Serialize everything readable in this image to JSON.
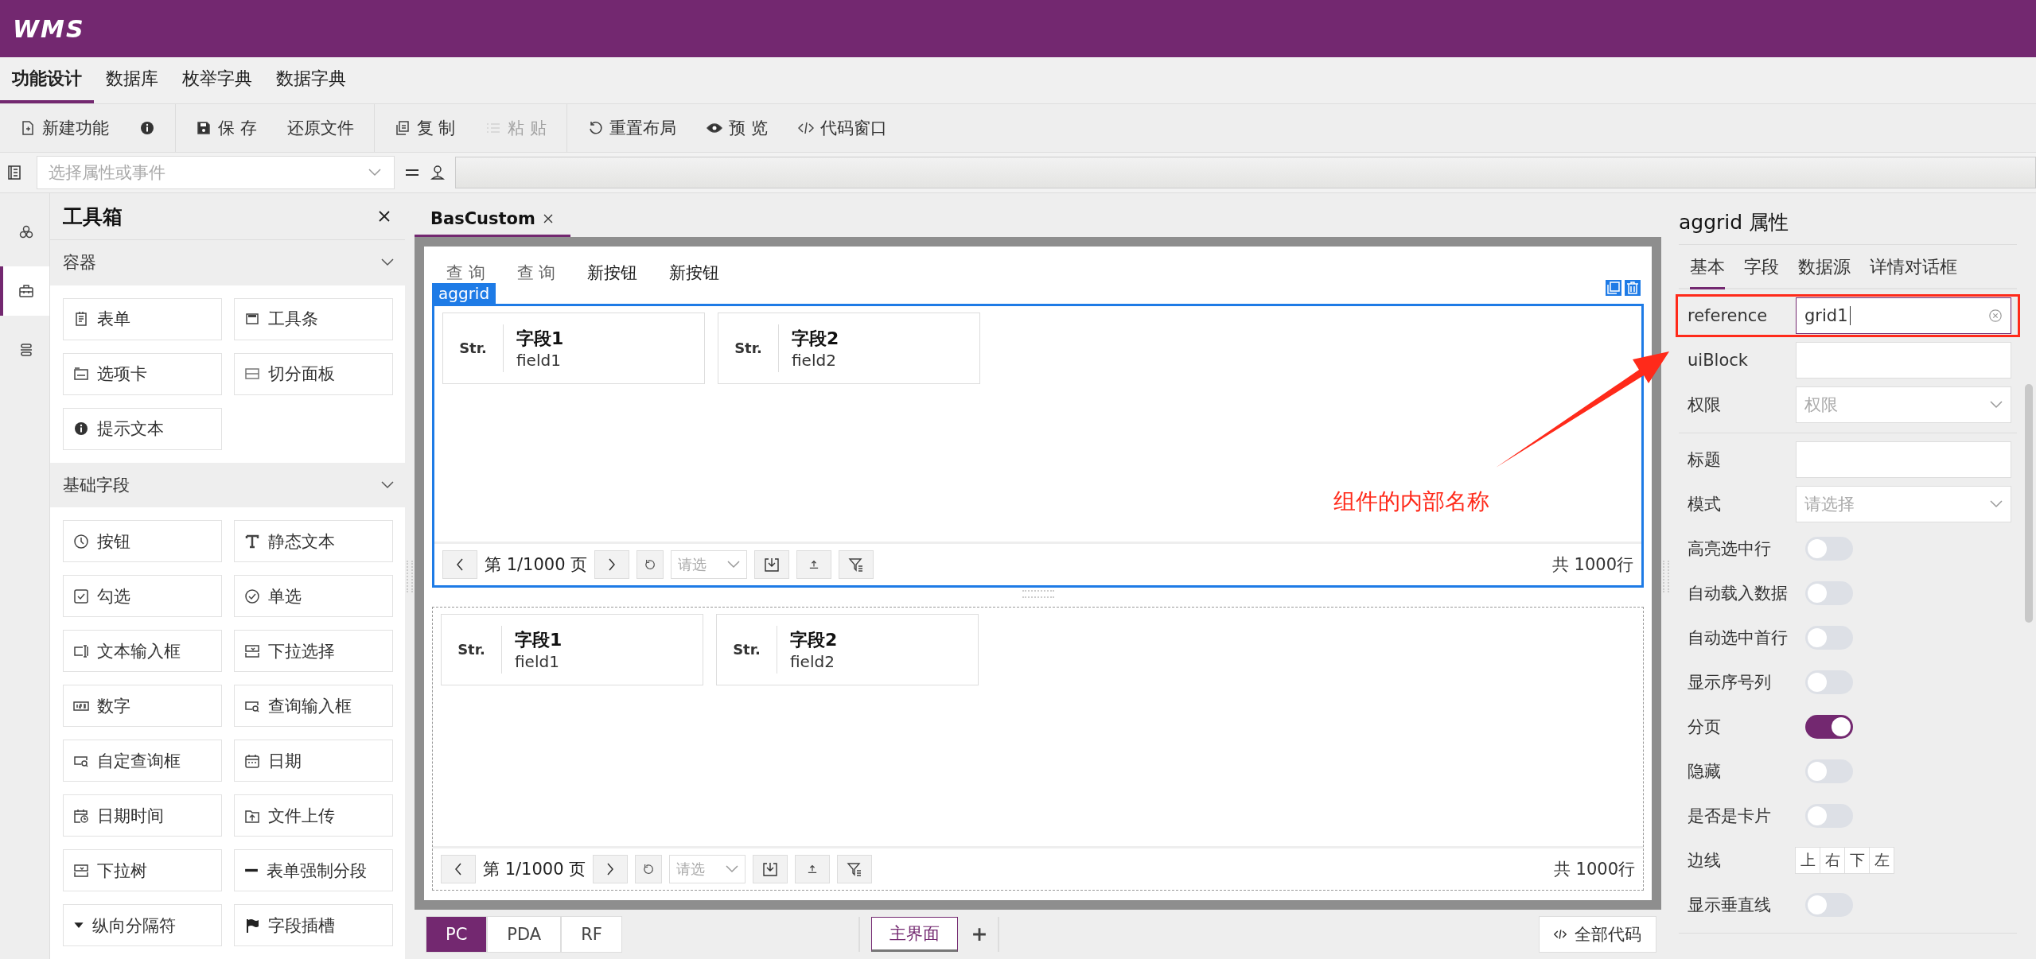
{
  "header": {
    "logo": "WMS"
  },
  "menu_tabs": [
    {
      "label": "功能设计",
      "selected": true
    },
    {
      "label": "数据库",
      "selected": false
    },
    {
      "label": "枚举字典",
      "selected": false
    },
    {
      "label": "数据字典",
      "selected": false
    }
  ],
  "toolbar": [
    [
      {
        "kind": "text",
        "label": "新建功能",
        "disabled": false
      },
      {
        "kind": "icon",
        "disabled": false
      }
    ],
    [
      {
        "label": "保 存",
        "disabled": false
      },
      {
        "label": "还原文件",
        "disabled": false
      }
    ],
    [
      {
        "label": "复 制",
        "disabled": false
      },
      {
        "label": "粘 贴",
        "disabled": true
      }
    ],
    [
      {
        "label": "重置布局",
        "disabled": false
      },
      {
        "label": "预 览",
        "disabled": false
      },
      {
        "label": "代码窗口",
        "disabled": false
      }
    ]
  ],
  "property_bar": {
    "placeholder": "选择属性或事件"
  },
  "side_rail": [
    {
      "selected": false
    },
    {
      "selected": true
    },
    {
      "selected": false
    }
  ],
  "toolbox": {
    "title": "工具箱",
    "sections": [
      {
        "title": "容器",
        "expanded": true,
        "items": [
          "表单",
          "工具条",
          "选项卡",
          "切分面板",
          "提示文本"
        ]
      },
      {
        "title": "基础字段",
        "expanded": true,
        "items": [
          "按钮",
          "静态文本",
          "勾选",
          "单选",
          "文本输入框",
          "下拉选择",
          "数字",
          "查询输入框",
          "自定查询框",
          "日期",
          "日期时间",
          "文件上传",
          "下拉树",
          "表单强制分段",
          "纵向分隔符",
          "字段插槽"
        ]
      }
    ]
  },
  "editor_tabs": [
    {
      "label": "BasCustom",
      "selected": true
    }
  ],
  "canvas": {
    "buttons": [
      {
        "label": "查 询",
        "disabled": true
      },
      {
        "label": "查 询",
        "disabled": true
      },
      {
        "label": "新按钮",
        "disabled": false
      },
      {
        "label": "新按钮",
        "disabled": false
      }
    ],
    "grids": [
      {
        "selected": true,
        "tag": "aggrid",
        "cards": [
          {
            "type": "Str.",
            "title": "字段1",
            "field": "field1"
          },
          {
            "type": "Str.",
            "title": "字段2",
            "field": "field2"
          }
        ],
        "pager": {
          "page": "第 1/1000 页",
          "placeholder": "请选",
          "total": "共 1000行"
        }
      },
      {
        "selected": false,
        "cards": [
          {
            "type": "Str.",
            "title": "字段1",
            "field": "field1"
          },
          {
            "type": "Str.",
            "title": "字段2",
            "field": "field2"
          }
        ],
        "pager": {
          "page": "第 1/1000 页",
          "placeholder": "请选",
          "total": "共 1000行"
        }
      }
    ]
  },
  "platform_tabs": [
    {
      "label": "PC",
      "selected": true
    },
    {
      "label": "PDA",
      "selected": false
    },
    {
      "label": "RF",
      "selected": false
    }
  ],
  "page_tabs": [
    {
      "label": "主界面",
      "selected": true
    }
  ],
  "all_code_button": "全部代码",
  "properties": {
    "title": "aggrid 属性",
    "tabs": [
      {
        "label": "基本",
        "selected": true
      },
      {
        "label": "字段",
        "selected": false
      },
      {
        "label": "数据源",
        "selected": false
      },
      {
        "label": "详情对话框",
        "selected": false
      }
    ],
    "groups": [
      [
        {
          "kind": "input",
          "label": "reference",
          "value": "grid1",
          "highlighted": true
        },
        {
          "kind": "input",
          "label": "uiBlock",
          "highlighted": false
        },
        {
          "kind": "select",
          "label": "权限",
          "placeholder": "权限",
          "highlighted": false
        }
      ],
      [
        {
          "kind": "input",
          "label": "标题",
          "highlighted": false
        },
        {
          "kind": "select",
          "label": "模式",
          "placeholder": "请选择",
          "highlighted": false
        },
        {
          "kind": "toggle",
          "label": "高亮选中行",
          "on": false
        },
        {
          "kind": "toggle",
          "label": "自动载入数据",
          "on": false
        },
        {
          "kind": "toggle",
          "label": "自动选中首行",
          "on": false
        },
        {
          "kind": "toggle",
          "label": "显示序号列",
          "on": false
        },
        {
          "kind": "toggle",
          "label": "分页",
          "on": true
        },
        {
          "kind": "toggle",
          "label": "隐藏",
          "on": false
        },
        {
          "kind": "toggle",
          "label": "是否是卡片",
          "on": false
        },
        {
          "kind": "segments",
          "label": "边线",
          "options": [
            "上",
            "右",
            "下",
            "左"
          ]
        },
        {
          "kind": "toggle",
          "label": "显示垂直线",
          "on": false
        }
      ]
    ]
  },
  "annotation": {
    "text": "组件的内部名称"
  }
}
